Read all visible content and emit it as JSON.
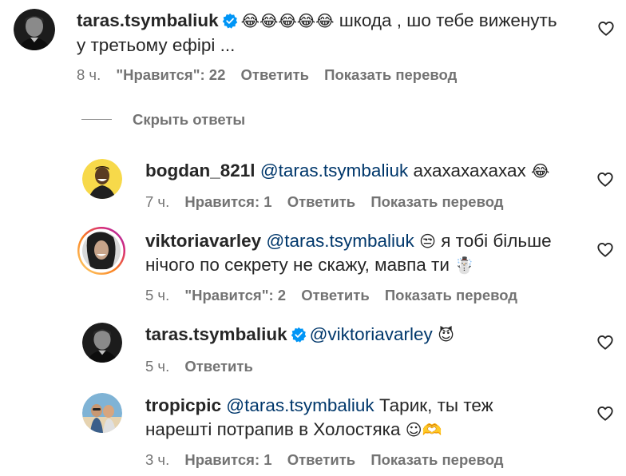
{
  "colors": {
    "text": "#262626",
    "secondary": "#737373",
    "mention": "#00376b",
    "verified": "#0095f6",
    "story_ring_start": "#feda75",
    "story_ring_end": "#d62976"
  },
  "main_comment": {
    "username": "taras.tsymbaliuk",
    "verified": true,
    "emojis": "😂😂😂😂😂",
    "text_line1": " шкода , шо тебе виженуть",
    "text_line2": "у третьому ефірі ...",
    "time": "8 ч.",
    "likes": "\"Нравится\": 22",
    "reply": "Ответить",
    "translate": "Показать перевод",
    "icon": "heart-icon"
  },
  "hide_replies": "Скрыть ответы",
  "replies": [
    {
      "username": "bogdan_821l",
      "mention": "@taras.tsymbaliuk",
      "text_line1": " ахахахахахах ",
      "emoji": "😂",
      "time": "7 ч.",
      "likes": "Нравится: 1",
      "reply": "Ответить",
      "translate": "Показать перевод"
    },
    {
      "username": "viktoriavarley",
      "mention": "@taras.tsymbaliuk",
      "emoji1": " 😒",
      "text_line1": " я тобі більше",
      "text_line2": "нічого по секрету не скажу, мавпа ти ",
      "emoji2": "☃️",
      "time": "5 ч.",
      "likes": "\"Нравится\": 2",
      "reply": "Ответить",
      "translate": "Показать перевод"
    },
    {
      "username": "taras.tsymbaliuk",
      "verified": true,
      "mention": "@viktoriavarley",
      "emoji": " 😈",
      "time": "5 ч.",
      "reply": "Ответить"
    },
    {
      "username": "tropicpic",
      "mention": "@taras.tsymbaliuk",
      "text_line1": " Тарик, ты теж",
      "text_line2": "нарешті потрапив в Холостяка ",
      "emoji": "☺🫶",
      "time": "3 ч.",
      "likes": "Нравится: 1",
      "reply": "Ответить",
      "translate": "Показать перевод"
    }
  ]
}
